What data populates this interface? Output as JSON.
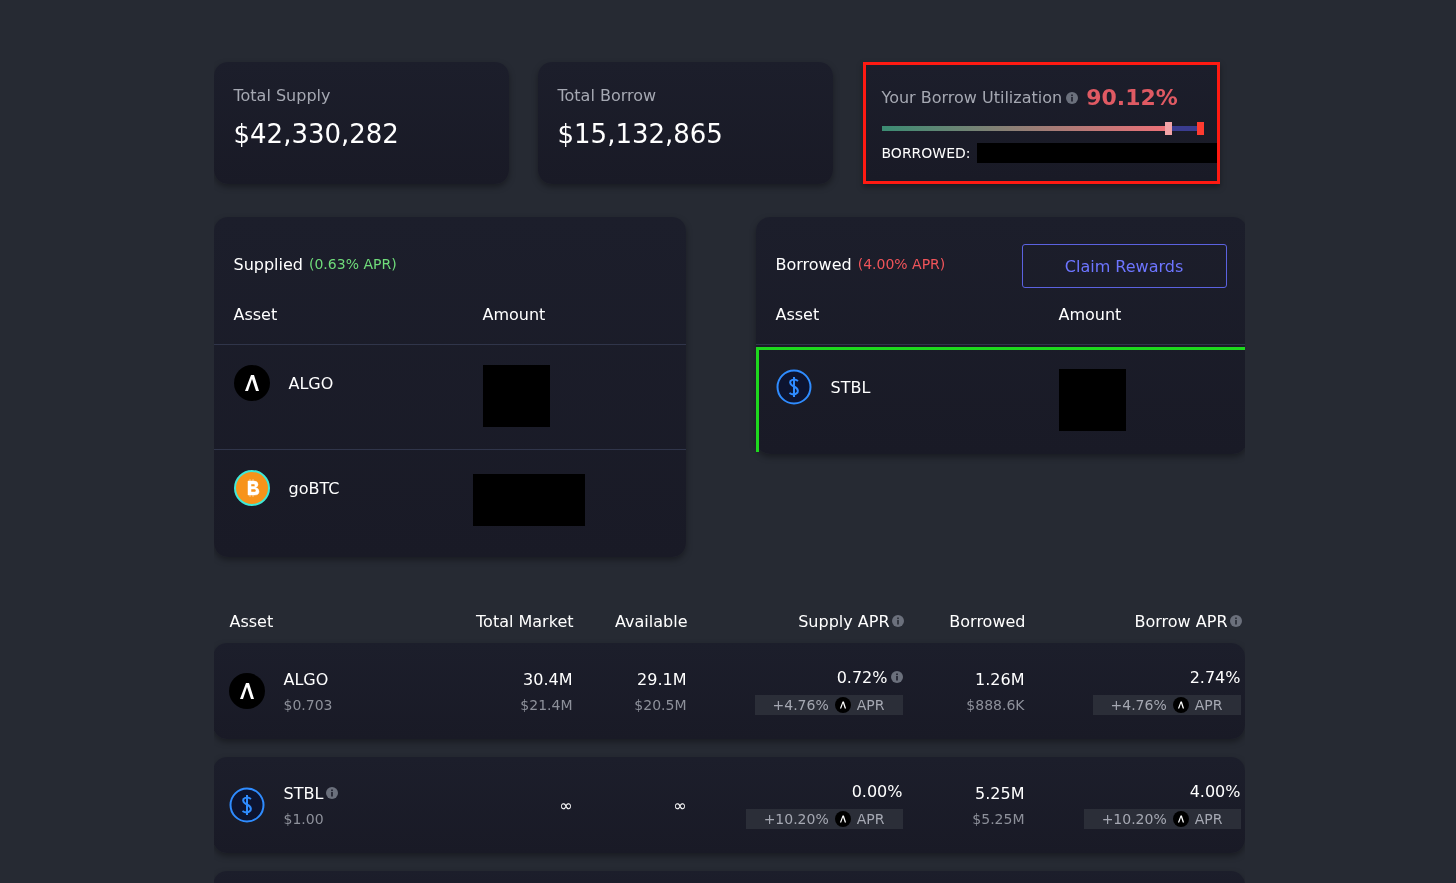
{
  "stats": [
    {
      "label": "Total Supply",
      "value": "$42,330,282"
    },
    {
      "label": "Total Borrow",
      "value": "$15,132,865"
    }
  ],
  "utilization": {
    "label": "Your Borrow Utilization",
    "value": "90.12%",
    "level": 0.9012,
    "borrowed_label": "BORROWED:"
  },
  "supplied": {
    "title": "Supplied",
    "apr": "(0.63% APR)",
    "columns": [
      "Asset",
      "Amount"
    ],
    "rows": [
      {
        "asset": "ALGO",
        "kind": "algo"
      },
      {
        "asset": "goBTC",
        "kind": "btc"
      }
    ]
  },
  "borrowed": {
    "title": "Borrowed",
    "apr": "(4.00% APR)",
    "button": "Claim Rewards",
    "columns": [
      "Asset",
      "Amount"
    ],
    "rows": [
      {
        "asset": "STBL",
        "kind": "stbl"
      }
    ]
  },
  "market": {
    "columns": [
      {
        "label": "Asset",
        "info": false
      },
      {
        "label": "Total Market",
        "info": false
      },
      {
        "label": "Available",
        "info": false
      },
      {
        "label": "Supply APR",
        "info": true
      },
      {
        "label": "Borrowed",
        "info": false
      },
      {
        "label": "Borrow APR",
        "info": true
      }
    ],
    "rows": [
      {
        "asset": "ALGO",
        "kind": "algo",
        "info": false,
        "price": "$0.703",
        "total": "30.4M",
        "total_usd": "$21.4M",
        "available": "29.1M",
        "available_usd": "$20.5M",
        "supply_apr": "0.72%",
        "supply_info": true,
        "supply_reward": "+4.76%",
        "supply_reward_label": "APR",
        "borrowed": "1.26M",
        "borrowed_usd": "$888.6K",
        "borrow_apr": "2.74%",
        "borrow_reward": "+4.76%",
        "borrow_reward_label": "APR"
      },
      {
        "asset": "STBL",
        "kind": "stbl",
        "info": true,
        "price": "$1.00",
        "total": "∞",
        "available": "∞",
        "supply_apr": "0.00%",
        "supply_info": false,
        "supply_reward": "+10.20%",
        "supply_reward_label": "APR",
        "borrowed": "5.25M",
        "borrowed_usd": "$5.25M",
        "borrow_apr": "4.00%",
        "borrow_reward": "+10.20%",
        "borrow_reward_label": "APR"
      }
    ]
  }
}
